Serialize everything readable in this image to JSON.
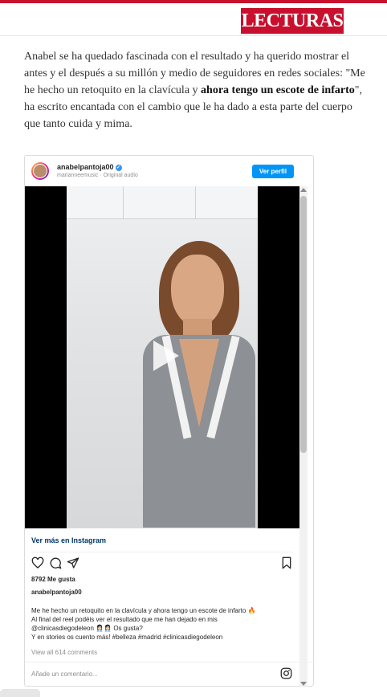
{
  "colors": {
    "brand": "#c8102e",
    "ig_blue": "#0095f6",
    "ig_link": "#00376b",
    "muted": "#8e8e8e"
  },
  "header": {
    "logo_text": "LECTURAS"
  },
  "article": {
    "text_before": "Anabel se ha quedado fascinada con el resultado y ha querido mostrar el antes y el después a su millón y medio de seguidores en redes sociales: \"Me he hecho un retoquito en la clavícula y ",
    "bold": "ahora tengo un escote de infarto",
    "text_after": "\", ha escrito encantada con el cambio que le ha dado a esta parte del cuerpo que tanto cuida y mima."
  },
  "instagram": {
    "username": "anabelpantoja00",
    "audio": "marianneemusic · Original audio",
    "follow_button": "Ver perfil",
    "view_more": "Ver más en Instagram",
    "likes": "8792 Me gusta",
    "owner": "anabelpantoja00",
    "caption_lines": [
      "Me he hecho un retoquito en la clavícula y ahora tengo un escote de infarto 🔥",
      "Al final del reel podéis ver el resultado que me han dejado en mis",
      "@clinicasdiegodeleon 👩🏻‍⚕️👩🏻‍⚕️ Os gusta?",
      "Y en stories os cuento más! #belleza #madrid #clinicasdiegodeleon"
    ],
    "comments_link": "View all 614 comments",
    "add_comment_placeholder": "Añade un comentario...",
    "icons": [
      "heart-icon",
      "comment-icon",
      "share-icon",
      "bookmark-icon",
      "play-icon",
      "instagram-icon",
      "verified-icon"
    ]
  }
}
